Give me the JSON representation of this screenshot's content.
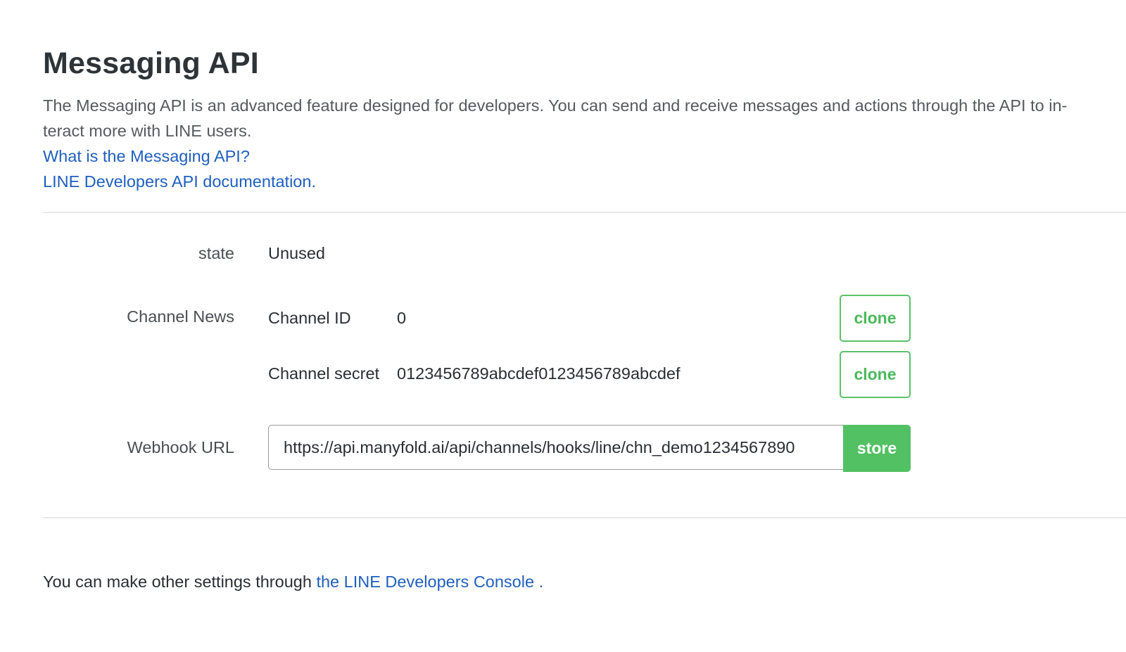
{
  "page": {
    "title": "Messaging API",
    "description": "The Messaging API is an advanced feature designed for developers. You can send and receive messages and actions through the API to in-teract more with LINE users.",
    "links": {
      "what_is": "What is the Messaging API?",
      "docs": "LINE Developers API documentation."
    }
  },
  "settings": {
    "state": {
      "label": "state",
      "value": "Unused"
    },
    "channel_news": {
      "label": "Channel News",
      "channel_id_label": "Channel ID",
      "channel_id_value": "0",
      "channel_secret_label": "Channel secret",
      "channel_secret_value": "0123456789abcdef0123456789abcdef",
      "clone_label": "clone"
    },
    "webhook": {
      "label": "Webhook URL",
      "value": "https://api.manyfold.ai/api/channels/hooks/line/chn_demo1234567890",
      "store_label": "store"
    }
  },
  "footer": {
    "text": "You can make other settings through ",
    "link": "the LINE Developers Console .",
    "link_color": "#1f5fbf"
  },
  "colors": {
    "accent_green": "#52c163",
    "link_blue": "#1f5fbf"
  }
}
